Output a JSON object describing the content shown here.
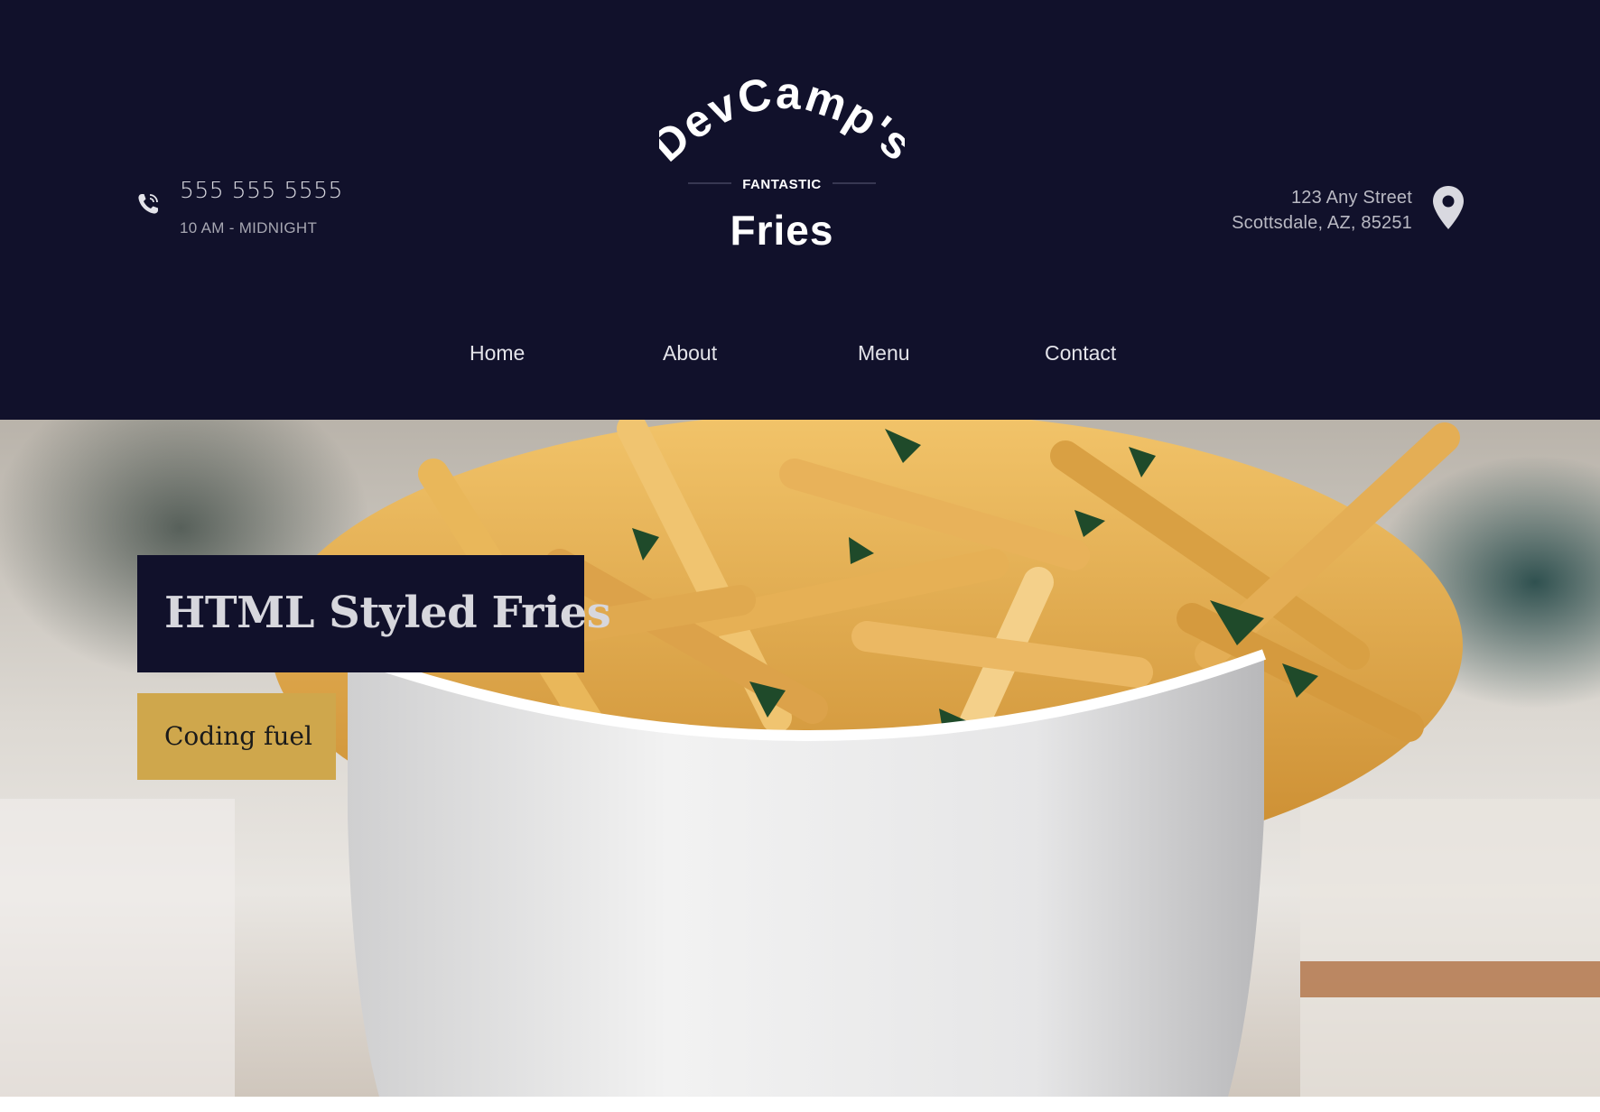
{
  "header": {
    "phone": "555 555 5555",
    "hours": "10 AM - MIDNIGHT",
    "logo": {
      "top_text": "DevCamp's",
      "middle_text": "FANTASTIC",
      "bottom_text": "Fries"
    },
    "address": {
      "line1": "123 Any Street",
      "line2": "Scottsdale, AZ, 85251"
    },
    "icons": {
      "phone": "phone-icon",
      "location": "map-pin-icon"
    }
  },
  "nav": {
    "items": [
      {
        "label": "Home"
      },
      {
        "label": "About"
      },
      {
        "label": "Menu"
      },
      {
        "label": "Contact"
      }
    ]
  },
  "hero": {
    "title": "HTML Styled Fries",
    "button_label": "Coding fuel"
  },
  "colors": {
    "header_bg": "#11112b",
    "accent": "#cfa74c",
    "text_light": "#d7d7dd"
  }
}
